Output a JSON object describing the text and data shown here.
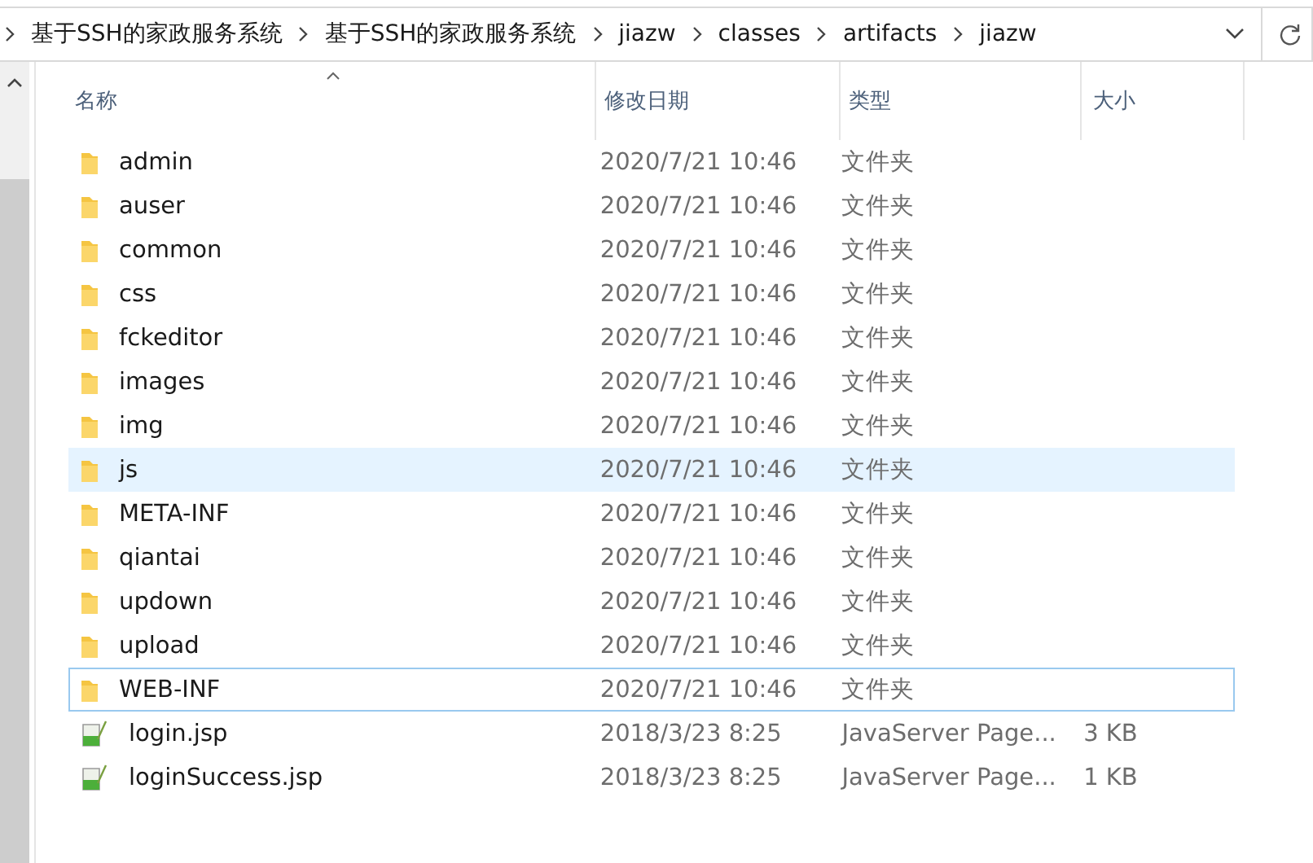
{
  "breadcrumb": [
    "基于SSH的家政服务系统",
    "基于SSH的家政服务系统",
    "jiazw",
    "classes",
    "artifacts",
    "jiazw"
  ],
  "columns": [
    {
      "label": "名称",
      "sorted": true
    },
    {
      "label": "修改日期",
      "sorted": false
    },
    {
      "label": "类型",
      "sorted": false
    },
    {
      "label": "大小",
      "sorted": false
    }
  ],
  "rows": [
    {
      "kind": "folder",
      "name": "admin",
      "date": "2020/7/21 10:46",
      "type": "文件夹",
      "highlighted": false,
      "focused": false
    },
    {
      "kind": "folder",
      "name": "auser",
      "date": "2020/7/21 10:46",
      "type": "文件夹",
      "highlighted": false,
      "focused": false
    },
    {
      "kind": "folder",
      "name": "common",
      "date": "2020/7/21 10:46",
      "type": "文件夹",
      "highlighted": false,
      "focused": false
    },
    {
      "kind": "folder",
      "name": "css",
      "date": "2020/7/21 10:46",
      "type": "文件夹",
      "highlighted": false,
      "focused": false
    },
    {
      "kind": "folder",
      "name": "fckeditor",
      "date": "2020/7/21 10:46",
      "type": "文件夹",
      "highlighted": false,
      "focused": false
    },
    {
      "kind": "folder",
      "name": "images",
      "date": "2020/7/21 10:46",
      "type": "文件夹",
      "highlighted": false,
      "focused": false
    },
    {
      "kind": "folder",
      "name": "img",
      "date": "2020/7/21 10:46",
      "type": "文件夹",
      "highlighted": false,
      "focused": false
    },
    {
      "kind": "folder",
      "name": "js",
      "date": "2020/7/21 10:46",
      "type": "文件夹",
      "highlighted": true,
      "focused": false
    },
    {
      "kind": "folder",
      "name": "META-INF",
      "date": "2020/7/21 10:46",
      "type": "文件夹",
      "highlighted": false,
      "focused": false
    },
    {
      "kind": "folder",
      "name": "qiantai",
      "date": "2020/7/21 10:46",
      "type": "文件夹",
      "highlighted": false,
      "focused": false
    },
    {
      "kind": "folder",
      "name": "updown",
      "date": "2020/7/21 10:46",
      "type": "文件夹",
      "highlighted": false,
      "focused": false
    },
    {
      "kind": "folder",
      "name": "upload",
      "date": "2020/7/21 10:46",
      "type": "文件夹",
      "highlighted": false,
      "focused": false
    },
    {
      "kind": "folder",
      "name": "WEB-INF",
      "date": "2020/7/21 10:46",
      "type": "文件夹",
      "highlighted": false,
      "focused": true
    },
    {
      "kind": "jsp",
      "name": "login.jsp",
      "date": "2018/3/23 8:25",
      "type": "JavaServer Page...",
      "size": "3 KB",
      "highlighted": false,
      "focused": false
    },
    {
      "kind": "jsp",
      "name": "loginSuccess.jsp",
      "date": "2018/3/23 8:25",
      "type": "JavaServer Page...",
      "size": "1 KB",
      "highlighted": false,
      "focused": false
    }
  ]
}
